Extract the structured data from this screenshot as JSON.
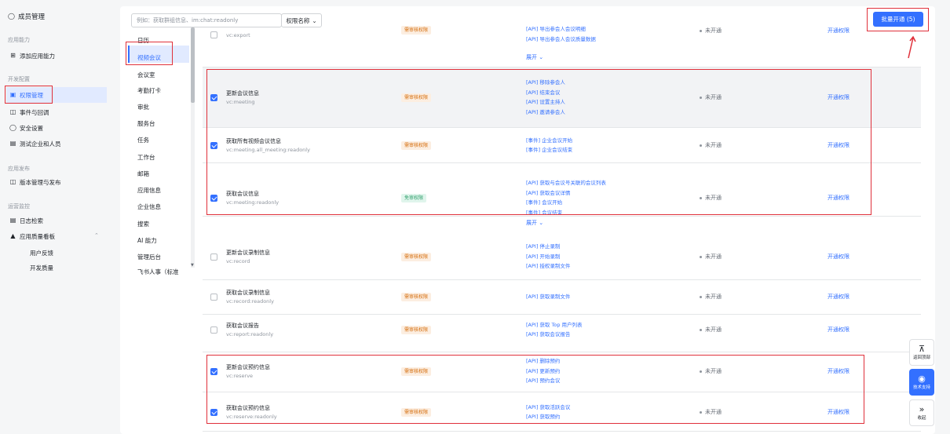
{
  "sidebar": {
    "top_label": "成员管理",
    "groups": [
      {
        "label": "应用能力"
      },
      {
        "label": "开发配置"
      },
      {
        "label": "应用发布"
      },
      {
        "label": "运营监控"
      }
    ],
    "items": [
      {
        "label": "添加应用能力"
      },
      {
        "label": "权限管理"
      },
      {
        "label": "事件与回调"
      },
      {
        "label": "安全设置"
      },
      {
        "label": "测试企业和人员"
      },
      {
        "label": "版本管理与发布"
      },
      {
        "label": "日志检索"
      },
      {
        "label": "应用质量看板"
      }
    ],
    "subitems": [
      "用户反馈",
      "开发质量"
    ]
  },
  "search": {
    "placeholder": "例如：获取群组信息、im:chat:readonly",
    "select_label": "权限名称"
  },
  "batch_button": "批量开通 (5)",
  "categories": [
    "日历",
    "视频会议",
    "会议室",
    "考勤打卡",
    "审批",
    "服务台",
    "任务",
    "工作台",
    "邮箱",
    "应用信息",
    "企业信息",
    "搜索",
    "AI 能力",
    "管理后台",
    "飞书人事（标准"
  ],
  "expand_label": "展开",
  "status_label": "未开通",
  "open_label": "开通权限",
  "tags": {
    "audit": "需审核权限",
    "free": "免审权限"
  },
  "rows": [
    {
      "name": "",
      "code": "vc:export",
      "tag": "audit",
      "checked": false,
      "apis": [
        "[API] 导出参会人会议明细",
        "[API] 导出参会人会议质量数据"
      ]
    },
    {
      "name": "更新会议信息",
      "code": "vc:meeting",
      "tag": "audit",
      "checked": true,
      "apis": [
        "[API] 移除参会人",
        "[API] 结束会议",
        "[API] 设置主持人",
        "[API] 邀请参会人"
      ]
    },
    {
      "name": "获取所有视频会议信息",
      "code": "vc:meeting.all_meeting:readonly",
      "tag": "audit",
      "checked": true,
      "apis": [
        "[事件] 企业会议开始",
        "[事件] 企业会议结束"
      ]
    },
    {
      "name": "获取会议信息",
      "code": "vc:meeting:readonly",
      "tag": "free",
      "checked": true,
      "apis": [
        "[API] 获取与会议号关联的会议列表",
        "[API] 获取会议详情",
        "[事件] 会议开始",
        "[事件] 会议结束"
      ]
    },
    {
      "name": "更新会议录制信息",
      "code": "vc:record",
      "tag": "audit",
      "checked": false,
      "apis": [
        "[API] 停止录制",
        "[API] 开始录制",
        "[API] 授权录制文件"
      ]
    },
    {
      "name": "获取会议录制信息",
      "code": "vc:record:readonly",
      "tag": "audit",
      "checked": false,
      "apis": [
        "[API] 获取录制文件"
      ]
    },
    {
      "name": "获取会议报告",
      "code": "vc:report:readonly",
      "tag": "audit",
      "checked": false,
      "apis": [
        "[API] 获取 Top 用户列表",
        "[API] 获取会议报告"
      ]
    },
    {
      "name": "更新会议预约信息",
      "code": "vc:reserve",
      "tag": "audit",
      "checked": true,
      "apis": [
        "[API] 删除预约",
        "[API] 更新预约",
        "[API] 预约会议"
      ]
    },
    {
      "name": "获取会议预约信息",
      "code": "vc:reserve:readonly",
      "tag": "audit",
      "checked": true,
      "apis": [
        "[API] 获取活跃会议",
        "[API] 获取预约"
      ]
    }
  ],
  "float": {
    "top_label": "返回顶部",
    "support_label": "技术支持",
    "collapse_label": "收起"
  },
  "colors": {
    "accent": "#3370ff",
    "highlight": "#e0303a",
    "audit_tag": "#d46b08",
    "free_tag": "#2e9e6a"
  }
}
